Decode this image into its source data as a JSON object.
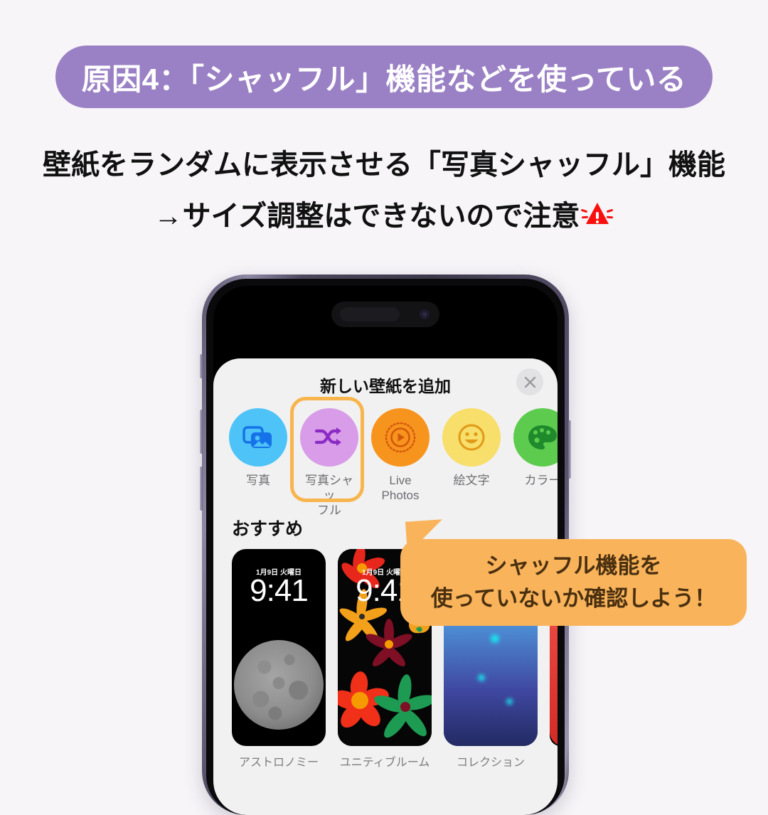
{
  "theme": {
    "page_bg": "#F7F5F8",
    "banner_purple": "#9A80C4",
    "bubble_orange": "#F9B45B",
    "highlight_orange": "#F8B54E",
    "warning_red": "#FA0E0E"
  },
  "banner": {
    "text": "原因4：「シャッフル」機能などを使っている"
  },
  "body": {
    "line1": "壁紙をランダムに表示させる「写真シャッフル」機能",
    "line2": "→サイズ調整はできないので注意",
    "warning_icon": "warning-triangle-icon"
  },
  "phone": {
    "model": "iPhone 14 Pro",
    "frame_color": "#4C465C",
    "buttons": [
      "silent-switch",
      "volume-up",
      "volume-down",
      "power"
    ]
  },
  "sheet": {
    "title": "新しい壁紙を追加",
    "close_icon": "close-x-icon",
    "categories": [
      {
        "label": "写真",
        "icon": "photos-stack-icon",
        "circle": "#4DC3F7",
        "glyph": "#1572E8",
        "selected": false
      },
      {
        "label": "写真シャッ\nフル",
        "label_line1": "写真シャッ",
        "label_line2": "フル",
        "icon": "shuffle-arrows-icon",
        "circle": "#D89CE8",
        "glyph": "#8B2BC4",
        "selected": true
      },
      {
        "label": "Live Photos",
        "icon": "live-photo-play-icon",
        "circle": "#F7941D",
        "glyph": "#D4580C",
        "selected": false
      },
      {
        "label": "絵文字",
        "icon": "smiley-face-icon",
        "circle": "#F8DE6A",
        "glyph": "#E09A18",
        "selected": false
      },
      {
        "label": "カラー",
        "icon": "color-palette-icon",
        "circle": "#5DCC4E",
        "glyph": "#1E8A2C",
        "selected": false
      }
    ],
    "recommended_heading": "おすすめ",
    "wallpapers": [
      {
        "label": "アストロノミー",
        "date": "1月9日 火曜日",
        "time": "9:41",
        "style": "astronomy-moon"
      },
      {
        "label": "ユニティブルーム",
        "date": "1月9日 火曜日",
        "time": "9:41",
        "style": "unity-bloom"
      },
      {
        "label": "コレクション",
        "date": "",
        "time": "",
        "style": "collection-bokeh"
      }
    ]
  },
  "callout": {
    "line1": "シャッフル機能を",
    "line2": "使っていないか確認しよう！"
  }
}
